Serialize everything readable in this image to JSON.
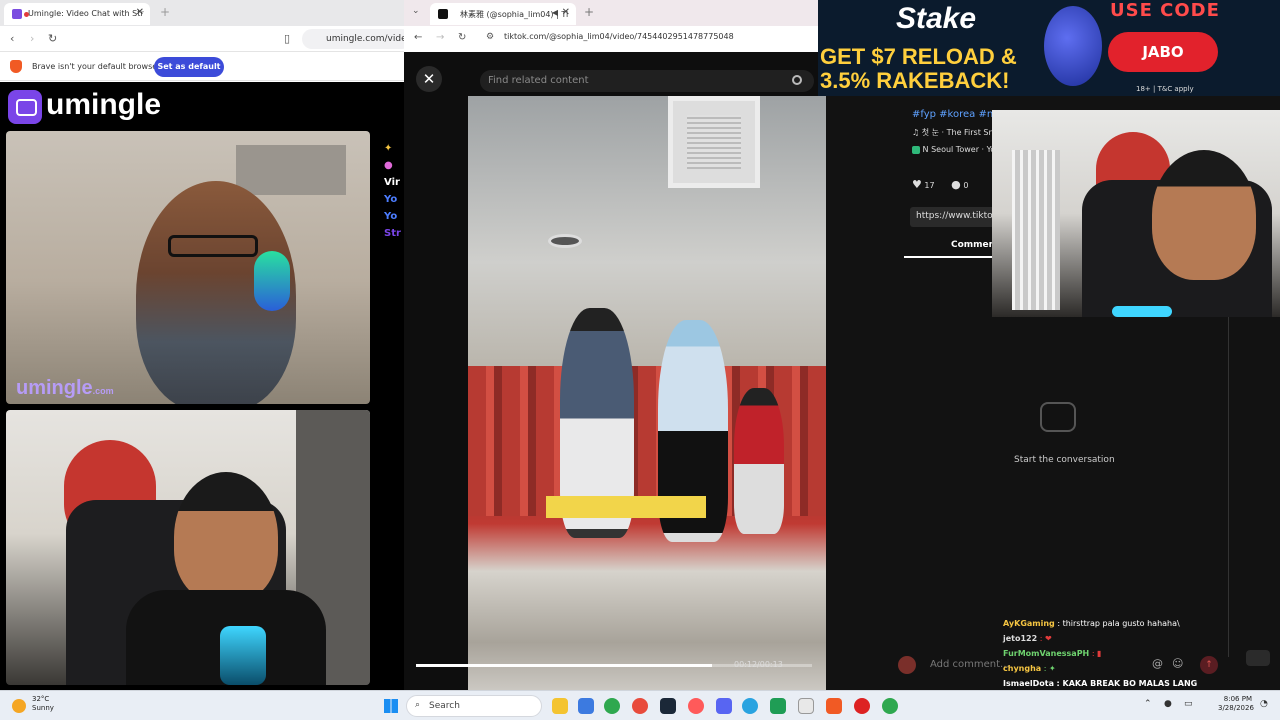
{
  "left_browser": {
    "tab_title": "Umingle: Video Chat with Str",
    "url": "umingle.com/video/",
    "info_text": "Brave isn't your default browser",
    "set_default_label": "Set as default",
    "logo_text": "umingle",
    "watermark": "umingle",
    "watermark_suffix": ".com",
    "side_text": [
      "Vir",
      "Yo",
      "Yo",
      "Str"
    ]
  },
  "tiktok": {
    "tab_title": "林素雅 (@sophia_lim04) | Ti",
    "url": "tiktok.com/@sophia_lim04/video/7454402951478775048",
    "search_placeholder": "Find related content",
    "video_time": "00:12/00:13",
    "progress": 0.92
  },
  "ad": {
    "brand": "Stake",
    "line1": "GET $7 RELOAD &",
    "line2": "3.5% RAKEBACK!",
    "use_code": "USE CODE",
    "code": "JABO",
    "tc": "18+ | T&C apply"
  },
  "post": {
    "hashtags": "#fyp #korea #nam",
    "music": "♫  첫 눈 · The First Sn",
    "location": "N Seoul Tower · Yo",
    "likes": "17",
    "comments": "0",
    "link": "https://www.tiktok",
    "comments_tab": "Comment",
    "empty_state": "Start the conversation",
    "add_comment_placeholder": "Add comment..."
  },
  "chat": [
    {
      "user": "AyKGaming",
      "text": ": thirsttrap pala gusto hahaha\\",
      "color": "#f5c542"
    },
    {
      "user": "jeto122",
      "text": ": ❤",
      "color": "#dddddd"
    },
    {
      "user": "FurMomVanessaPH",
      "text": ": ▮",
      "color": "#6fd36f"
    },
    {
      "user": "chyngha",
      "text": ": ✦",
      "color": "#f5c542"
    },
    {
      "user": "IsmaelDota",
      "text": ": KAKA BREAK BO MALAS LANG",
      "color": "#ffffff"
    }
  ],
  "taskbar": {
    "temp": "32°C",
    "condition": "Sunny",
    "search_label": "Search",
    "time": "8:06 PM",
    "date": "3/28/2026"
  }
}
